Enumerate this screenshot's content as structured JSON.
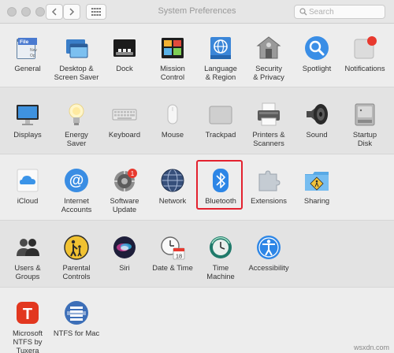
{
  "window": {
    "title": "System Preferences",
    "search_placeholder": "Search"
  },
  "colors": {
    "selection_outline": "#e3222f",
    "accent_blue": "#2d86e6"
  },
  "rows": [
    {
      "items": [
        {
          "label": "General",
          "icon": "general-icon"
        },
        {
          "label": "Desktop &\nScreen Saver",
          "icon": "desktop-icon"
        },
        {
          "label": "Dock",
          "icon": "dock-icon"
        },
        {
          "label": "Mission\nControl",
          "icon": "mission-control-icon"
        },
        {
          "label": "Language\n& Region",
          "icon": "language-icon"
        },
        {
          "label": "Security\n& Privacy",
          "icon": "security-icon"
        },
        {
          "label": "Spotlight",
          "icon": "spotlight-icon"
        },
        {
          "label": "Notifications",
          "icon": "notifications-icon"
        }
      ]
    },
    {
      "items": [
        {
          "label": "Displays",
          "icon": "displays-icon"
        },
        {
          "label": "Energy\nSaver",
          "icon": "energy-icon"
        },
        {
          "label": "Keyboard",
          "icon": "keyboard-icon"
        },
        {
          "label": "Mouse",
          "icon": "mouse-icon"
        },
        {
          "label": "Trackpad",
          "icon": "trackpad-icon"
        },
        {
          "label": "Printers &\nScanners",
          "icon": "printer-icon"
        },
        {
          "label": "Sound",
          "icon": "sound-icon"
        },
        {
          "label": "Startup\nDisk",
          "icon": "disk-icon"
        }
      ]
    },
    {
      "items": [
        {
          "label": "iCloud",
          "icon": "icloud-icon"
        },
        {
          "label": "Internet\nAccounts",
          "icon": "internet-accounts-icon"
        },
        {
          "label": "Software\nUpdate",
          "icon": "software-update-icon",
          "badge": "1"
        },
        {
          "label": "Network",
          "icon": "network-icon"
        },
        {
          "label": "Bluetooth",
          "icon": "bluetooth-icon",
          "selected": true
        },
        {
          "label": "Extensions",
          "icon": "extensions-icon"
        },
        {
          "label": "Sharing",
          "icon": "sharing-icon"
        }
      ]
    },
    {
      "items": [
        {
          "label": "Users &\nGroups",
          "icon": "users-icon"
        },
        {
          "label": "Parental\nControls",
          "icon": "parental-icon"
        },
        {
          "label": "Siri",
          "icon": "siri-icon"
        },
        {
          "label": "Date & Time",
          "icon": "date-time-icon",
          "calendar_day": "18"
        },
        {
          "label": "Time\nMachine",
          "icon": "time-machine-icon"
        },
        {
          "label": "Accessibility",
          "icon": "accessibility-icon"
        }
      ]
    },
    {
      "items": [
        {
          "label": "Microsoft\nNTFS by Tuxera",
          "icon": "tuxera-icon",
          "glyph": "T"
        },
        {
          "label": "NTFS for Mac",
          "icon": "ntfs-icon"
        }
      ]
    }
  ],
  "watermark": "wsxdn.com"
}
